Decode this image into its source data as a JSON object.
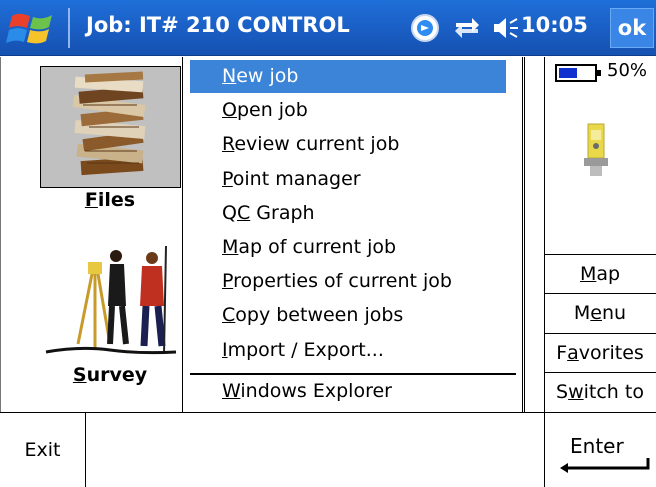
{
  "title_bar": {
    "title": "Job: IT# 210 CONTROL",
    "time": "10:05",
    "ok_label": "ok",
    "icons": [
      "windows-flag-icon",
      "gps-icon",
      "connectivity-icon",
      "volume-icon"
    ],
    "colors": {
      "bar": "#1a5ec4",
      "text": "#ffffff"
    }
  },
  "left_panel": {
    "files_label": "Files",
    "survey_label": "Survey"
  },
  "menu": {
    "items": [
      {
        "label": "New job",
        "selected": true
      },
      {
        "label": "Open job"
      },
      {
        "label": "Review current job"
      },
      {
        "label": "Point manager"
      },
      {
        "label": "QC Graph"
      },
      {
        "label": "Map of current job"
      },
      {
        "label": "Properties of current job"
      },
      {
        "label": "Copy between jobs"
      },
      {
        "label": "Import / Export..."
      },
      {
        "label": "Windows Explorer"
      }
    ],
    "selection_color": "#3c84d8"
  },
  "right_panel": {
    "battery_percent": "50%",
    "buttons": [
      "Map",
      "Menu",
      "Favorites",
      "Switch to"
    ]
  },
  "bottom_bar": {
    "exit_label": "Exit",
    "enter_label": "Enter"
  }
}
